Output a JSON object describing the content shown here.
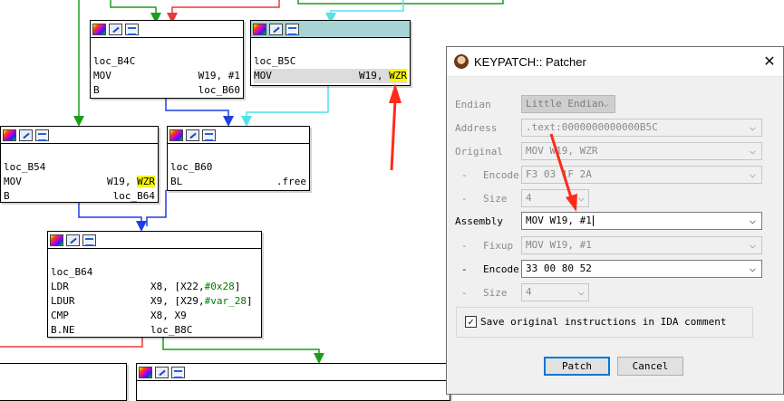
{
  "colors": {
    "edge_green": "#1a9e1a",
    "edge_red": "#e83a3a",
    "edge_blue": "#1f3fe6",
    "edge_cyan": "#4fe3ec",
    "annotation_red": "#ff2a1a",
    "highlight_yellow": "#f7f700",
    "selected_header": "#a6d3d3"
  },
  "nodes": {
    "b4c": {
      "label": "loc_B4C",
      "r1": {
        "mn": "MOV",
        "op1": "W19, ",
        "op2": "#1"
      },
      "r2": {
        "mn": "B",
        "op": "loc_B60"
      }
    },
    "b5c": {
      "label": "loc_B5C",
      "r1": {
        "mn": "MOV",
        "op1": "W19, ",
        "op2": "WZR"
      }
    },
    "b54": {
      "label": "loc_B54",
      "r1": {
        "mn": "MOV",
        "op1": "W19, ",
        "op2": "WZR"
      },
      "r2": {
        "mn": "B",
        "op": "loc_B64"
      }
    },
    "b60": {
      "label": "loc_B60",
      "r1": {
        "mn": "BL",
        "op": ".free"
      }
    },
    "b64": {
      "label": "loc_B64",
      "r1": {
        "mn": "LDR",
        "op_a": "X8, [X22,",
        "op_b": "#0x28",
        "op_c": "]"
      },
      "r2": {
        "mn": "LDUR",
        "op_a": "X9, [X29,",
        "op_b": "#var_28",
        "op_c": "]"
      },
      "r3": {
        "mn": "CMP",
        "op": "X8, X9"
      },
      "r4": {
        "mn": "B.NE",
        "op": "loc_B8C"
      }
    }
  },
  "dialog": {
    "title": "KEYPATCH:: Patcher",
    "close_glyph": "✕",
    "endian": {
      "label": "Endian",
      "value": "Little Endian"
    },
    "address": {
      "label": "Address",
      "value": ".text:0000000000000B5C"
    },
    "original": {
      "label": "Original",
      "value": "MOV W19, WZR"
    },
    "orig_encode": {
      "prefix": "-",
      "label": "Encode",
      "value": "F3 03 1F 2A"
    },
    "orig_size": {
      "prefix": "-",
      "label": "Size",
      "value": "4"
    },
    "assembly": {
      "label": "Assembly",
      "value": "MOV W19, #1"
    },
    "fixup": {
      "prefix": "-",
      "label": "Fixup",
      "value": "MOV W19, #1"
    },
    "new_encode": {
      "prefix": "-",
      "label": "Encode",
      "value": "33 00 80 52"
    },
    "new_size": {
      "prefix": "-",
      "label": "Size",
      "value": "4"
    },
    "save_comment": {
      "label": "Save original instructions in IDA comment",
      "checked": "✓"
    },
    "patch_button": "Patch",
    "cancel_button": "Cancel"
  }
}
